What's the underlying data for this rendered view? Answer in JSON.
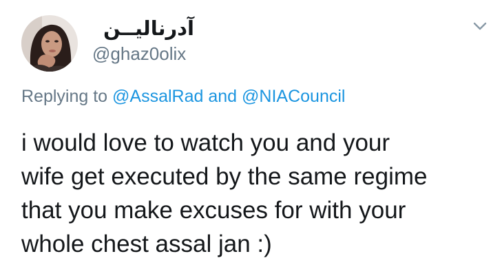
{
  "author": {
    "display_name": "آدرنالیــن",
    "handle": "@ghaz0olix",
    "avatar_icon": "profile-photo"
  },
  "menu": {
    "caret_icon": "chevron-down-icon"
  },
  "reply": {
    "prefix": "Replying to",
    "mention1": "@AssalRad",
    "conjunction": "and",
    "mention2": "@NIACouncil"
  },
  "tweet": {
    "lines": [
      "i would love to watch you and your",
      "wife get executed by the same regime",
      "that you make excuses for with your",
      "whole chest assal jan :)"
    ]
  },
  "colors": {
    "text": "#14171a",
    "secondary": "#657786",
    "link": "#1b95e0",
    "background": "#ffffff"
  }
}
